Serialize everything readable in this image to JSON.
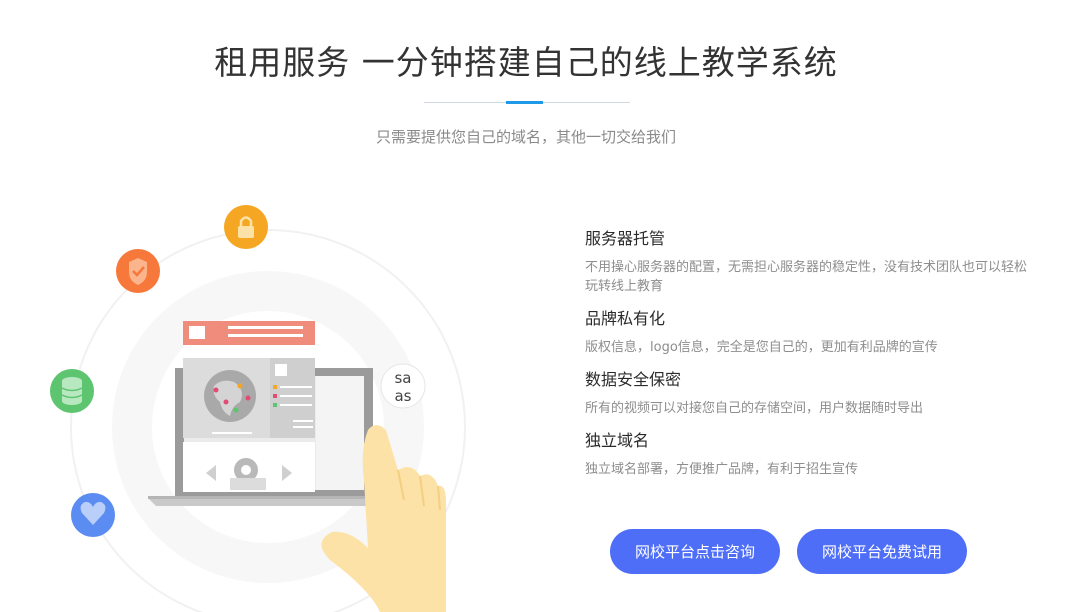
{
  "header": {
    "title": "租用服务 一分钟搭建自己的线上教学系统",
    "subtitle": "只需要提供您自己的域名，其他一切交给我们"
  },
  "illustration": {
    "saas_label": "saas",
    "icons": [
      "lock-icon",
      "shield-check-icon",
      "database-icon",
      "heart-icon"
    ]
  },
  "features": [
    {
      "title": "服务器托管",
      "desc": "不用操心服务器的配置，无需担心服务器的稳定性，没有技术团队也可以轻松玩转线上教育"
    },
    {
      "title": "品牌私有化",
      "desc": "版权信息，logo信息，完全是您自己的，更加有利品牌的宣传"
    },
    {
      "title": "数据安全保密",
      "desc": "所有的视频可以对接您自己的存储空间，用户数据随时导出"
    },
    {
      "title": "独立域名",
      "desc": "独立域名部署，方便推广品牌，有利于招生宣传"
    }
  ],
  "buttons": {
    "consult": "网校平台点击咨询",
    "trial": "网校平台免费试用"
  },
  "colors": {
    "accent": "#1e9ae8",
    "button": "#4f6ef7",
    "lock_circle": "#f5a623",
    "shield_circle": "#f6783a",
    "database_circle": "#5dc46f",
    "heart_circle": "#5b8cf2"
  }
}
